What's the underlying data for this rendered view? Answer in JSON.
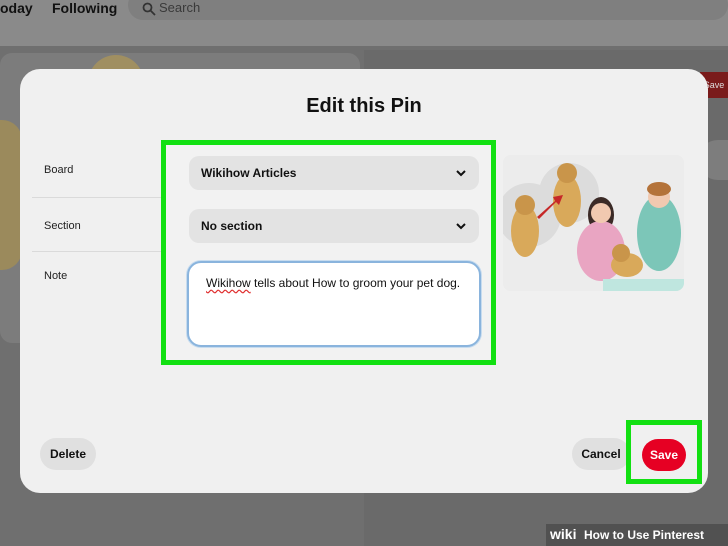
{
  "background": {
    "nav": {
      "today": "oday",
      "following": "Following"
    },
    "search": {
      "placeholder": "Search"
    },
    "right_save": "Save"
  },
  "modal": {
    "title": "Edit this Pin",
    "fields": {
      "board_label": "Board",
      "section_label": "Section",
      "note_label": "Note"
    },
    "board_value": "Wikihow Articles",
    "section_value": "No section",
    "note_word_misspelled": "Wikihow",
    "note_rest": " tells about How to groom your pet dog.",
    "buttons": {
      "delete": "Delete",
      "cancel": "Cancel",
      "save": "Save"
    }
  },
  "colors": {
    "highlight": "#12e012",
    "save_red": "#e60023"
  },
  "watermark": {
    "wiki": "wiki",
    "rest": "How to Use Pinterest"
  }
}
